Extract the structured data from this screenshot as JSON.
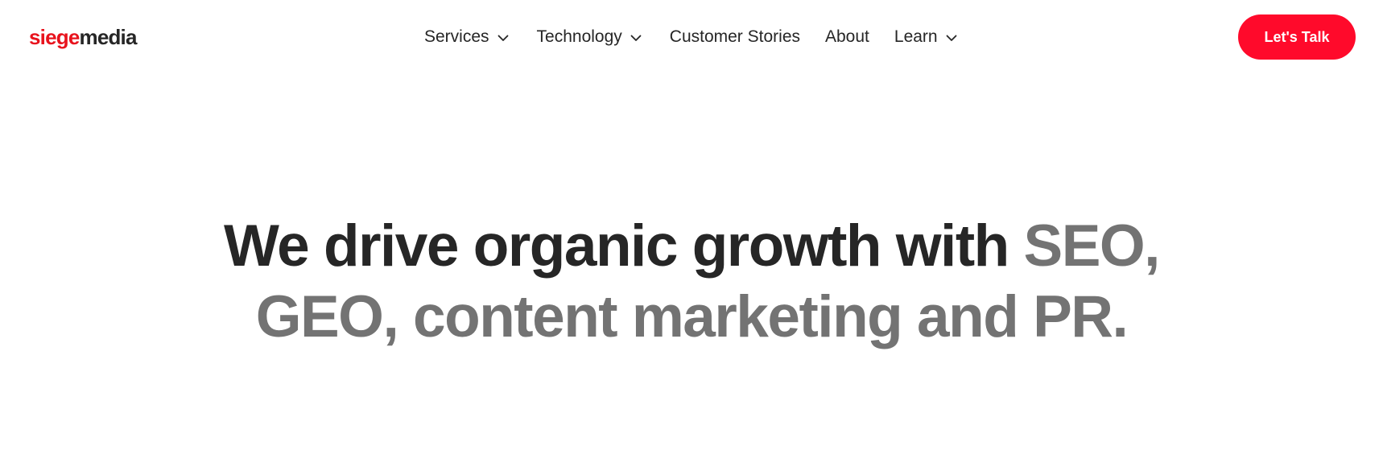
{
  "brand": {
    "logo_part_a": "siege",
    "logo_part_b": "media",
    "colors": {
      "accent": "#e8131d",
      "cta_bg": "#ff0a2b",
      "text_dark": "#262626",
      "text_muted": "#737373"
    }
  },
  "nav": {
    "items": [
      {
        "label": "Services",
        "has_dropdown": true,
        "icon": "chevron-down-icon"
      },
      {
        "label": "Technology",
        "has_dropdown": true,
        "icon": "chevron-down-icon"
      },
      {
        "label": "Customer Stories",
        "has_dropdown": false
      },
      {
        "label": "About",
        "has_dropdown": false
      },
      {
        "label": "Learn",
        "has_dropdown": true,
        "icon": "chevron-down-icon"
      }
    ]
  },
  "cta": {
    "label": "Let's Talk"
  },
  "hero": {
    "line1_dark": "We drive organic growth with ",
    "line1_muted": "SEO,",
    "line2_muted": "GEO, content marketing and PR."
  }
}
